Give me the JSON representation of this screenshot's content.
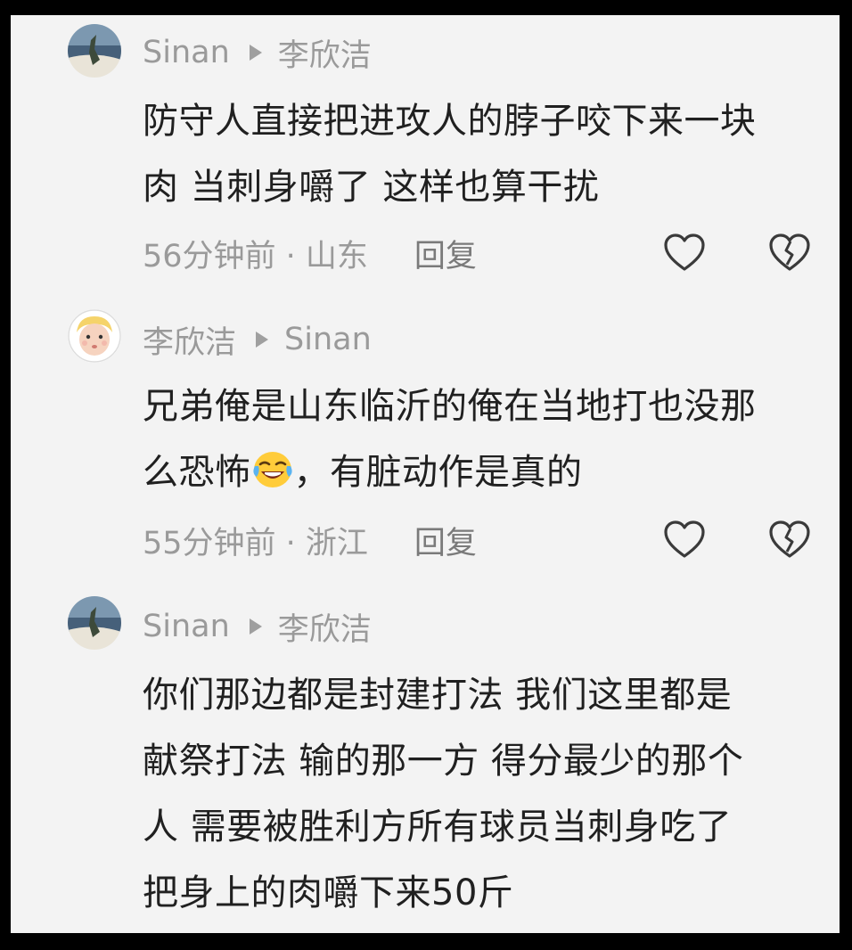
{
  "comments": [
    {
      "author": "Sinan",
      "reply_to": "李欣洁",
      "avatar": "landscape-avatar",
      "lines": [
        "防守人直接把进攻人的脖子咬下来一块",
        "肉 当刺身嚼了 这样也算干扰"
      ],
      "time_location": "56分钟前 · 山东",
      "reply_label": "回复"
    },
    {
      "author": "李欣洁",
      "reply_to": "Sinan",
      "avatar": "cartoon-face-avatar",
      "lines": [
        "兄弟俺是山东临沂的俺在当地打也没那",
        "么恐怖",
        "，有脏动作是真的"
      ],
      "time_location": "55分钟前 · 浙江",
      "reply_label": "回复"
    },
    {
      "author": "Sinan",
      "reply_to": "李欣洁",
      "avatar": "landscape-avatar",
      "lines": [
        "你们那边都是封建打法 我们这里都是",
        "献祭打法 输的那一方 得分最少的那个",
        "人 需要被胜利方所有球员当刺身吃了",
        "把身上的肉嚼下来50斤"
      ]
    }
  ],
  "icons": {
    "like": "heart-outline-icon",
    "dislike": "broken-heart-icon",
    "emoji": "laughing-crying-emoji"
  },
  "colors": {
    "background": "#f3f3f3",
    "text": "#202020",
    "secondary": "#9a9a9a"
  }
}
